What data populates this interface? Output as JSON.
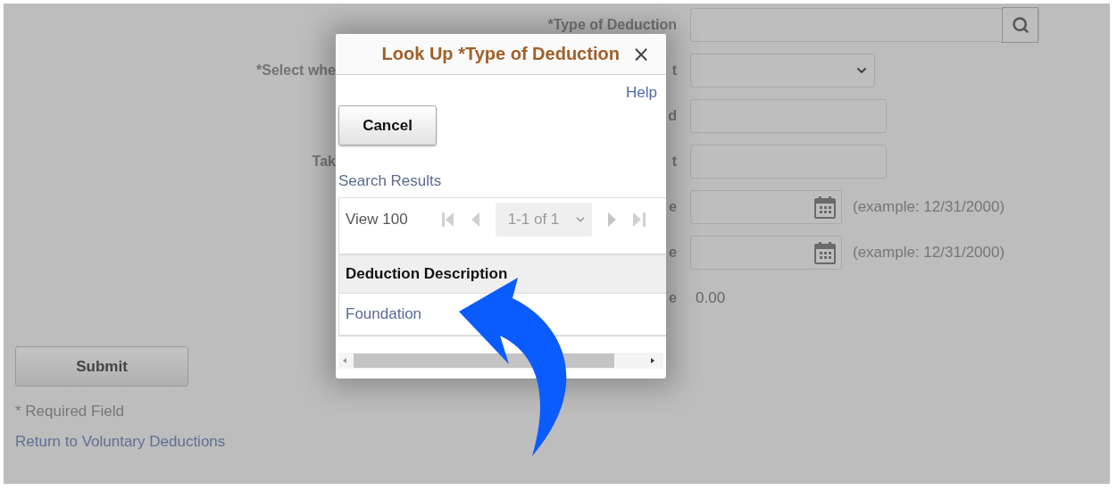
{
  "form": {
    "rows": [
      {
        "label": "*Type of Deduction",
        "kind": "lookup"
      },
      {
        "label_lead": "*Select whe",
        "label": "t",
        "kind": "select"
      },
      {
        "label": "d",
        "kind": "text"
      },
      {
        "label_lead": "Tak",
        "label": "t",
        "kind": "text"
      },
      {
        "label": "e",
        "kind": "date",
        "hint": "(example: 12/31/2000)"
      },
      {
        "label": "e",
        "kind": "date",
        "hint": "(example: 12/31/2000)"
      },
      {
        "label": "e",
        "kind": "value",
        "value": "0.00"
      }
    ]
  },
  "submit": "Submit",
  "required_note": "* Required Field",
  "return_link": "Return to Voluntary Deductions",
  "lookup_dialog": {
    "title": "Look Up *Type of Deduction",
    "close": "×",
    "help": "Help",
    "cancel": "Cancel",
    "results_title": "Search Results",
    "view_all": "View 100",
    "pager": "1-1 of 1",
    "column": "Deduction Description",
    "rows": [
      "Foundation"
    ]
  }
}
